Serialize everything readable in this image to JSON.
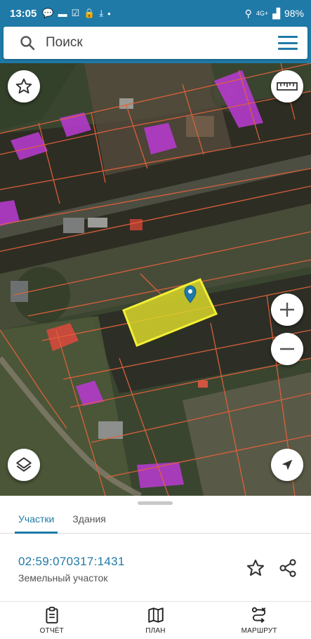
{
  "status_bar": {
    "time": "13:05",
    "network": "4G+",
    "battery": "98%"
  },
  "search": {
    "placeholder": "Поиск"
  },
  "icons": {
    "search": "search-icon",
    "menu": "menu-icon",
    "favorite": "star-icon",
    "ruler": "ruler-icon",
    "zoom_in": "plus-icon",
    "zoom_out": "minus-icon",
    "layers": "layers-icon",
    "locate": "navigation-arrow-icon",
    "share": "share-icon",
    "pin": "map-pin-icon"
  },
  "colors": {
    "accent": "#1f7aa8",
    "parcel_fill": "#d9d62a",
    "parcel_border": "#f2ef35",
    "boundary": "#e0623b",
    "building": "#b43bcb"
  },
  "tabs": [
    {
      "label": "Участки",
      "active": true
    },
    {
      "label": "Здания",
      "active": false
    }
  ],
  "parcel": {
    "number": "02:59:070317:1431",
    "type": "Земельный участок"
  },
  "bottom_nav": [
    {
      "label": "ОТЧЁТ",
      "icon": "clipboard-icon"
    },
    {
      "label": "ПЛАН",
      "icon": "map-icon"
    },
    {
      "label": "МАРШРУТ",
      "icon": "route-icon"
    }
  ]
}
